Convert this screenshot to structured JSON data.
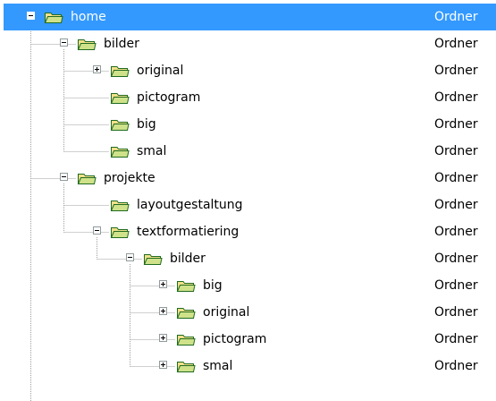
{
  "tree": {
    "nodes": [
      {
        "label": "home",
        "type": "Ordner",
        "depth": 0,
        "expander": "minus",
        "selected": true
      },
      {
        "label": "bilder",
        "type": "Ordner",
        "depth": 1,
        "expander": "minus",
        "selected": false
      },
      {
        "label": "original",
        "type": "Ordner",
        "depth": 2,
        "expander": "plus",
        "selected": false
      },
      {
        "label": "pictogram",
        "type": "Ordner",
        "depth": 2,
        "expander": "none",
        "selected": false
      },
      {
        "label": "big",
        "type": "Ordner",
        "depth": 2,
        "expander": "none",
        "selected": false
      },
      {
        "label": "smal",
        "type": "Ordner",
        "depth": 2,
        "expander": "none",
        "selected": false
      },
      {
        "label": "projekte",
        "type": "Ordner",
        "depth": 1,
        "expander": "minus",
        "selected": false
      },
      {
        "label": "layoutgestaltung",
        "type": "Ordner",
        "depth": 2,
        "expander": "none",
        "selected": false
      },
      {
        "label": "textformatiering",
        "type": "Ordner",
        "depth": 2,
        "expander": "minus",
        "selected": false
      },
      {
        "label": "bilder",
        "type": "Ordner",
        "depth": 3,
        "expander": "minus",
        "selected": false
      },
      {
        "label": "big",
        "type": "Ordner",
        "depth": 4,
        "expander": "plus",
        "selected": false
      },
      {
        "label": "original",
        "type": "Ordner",
        "depth": 4,
        "expander": "plus",
        "selected": false
      },
      {
        "label": "pictogram",
        "type": "Ordner",
        "depth": 4,
        "expander": "plus",
        "selected": false
      },
      {
        "label": "smal",
        "type": "Ordner",
        "depth": 4,
        "expander": "plus",
        "selected": false
      }
    ]
  },
  "colors": {
    "selection": "#3399ff",
    "selection_text": "#ffffff",
    "text": "#000000",
    "tree_line": "#a0a0a0",
    "expander_border": "#919b9c",
    "folder_body": "#f2e08a",
    "folder_front": "#cfe28a",
    "folder_outline": "#1f6b1f"
  },
  "icons": {
    "folder": "folder-open-icon",
    "expand": "plus-box-icon",
    "collapse": "minus-box-icon"
  }
}
